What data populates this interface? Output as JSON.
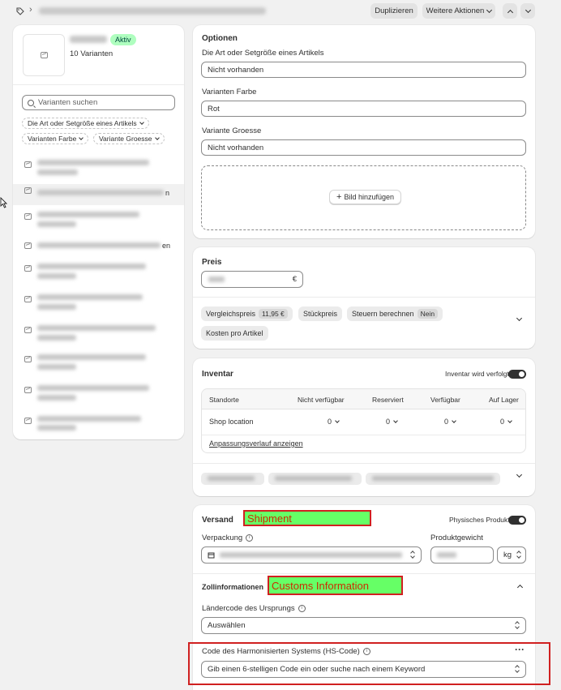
{
  "header": {
    "duplicate_label": "Duplizieren",
    "more_actions_label": "Weitere Aktionen"
  },
  "product": {
    "status": "Aktiv",
    "variant_count": "10 Varianten",
    "search_placeholder": "Varianten suchen",
    "filters": [
      "Die Art oder Setgröße eines Artikels",
      "Varianten Farbe",
      "Variante Groesse"
    ],
    "variant_trailing_text_1": "n",
    "variant_trailing_text_3": "en"
  },
  "options": {
    "title": "Optionen",
    "fields": [
      {
        "label": "Die Art oder Setgröße eines Artikels",
        "value": "Nicht vorhanden"
      },
      {
        "label": "Varianten Farbe",
        "value": "Rot"
      },
      {
        "label": "Variante Groesse",
        "value": "Nicht vorhanden"
      }
    ],
    "add_image_label": "Bild hinzufügen"
  },
  "price": {
    "title": "Preis",
    "currency": "€",
    "compare_label": "Vergleichspreis",
    "compare_value": "11,95 €",
    "unit_price_label": "Stückpreis",
    "tax_label": "Steuern berechnen",
    "tax_value": "Nein",
    "cost_label": "Kosten pro Artikel"
  },
  "inventory": {
    "title": "Inventar",
    "tracked_label": "Inventar wird verfolgt",
    "tracked": true,
    "columns": [
      "Standorte",
      "Nicht verfügbar",
      "Reserviert",
      "Verfügbar",
      "Auf Lager"
    ],
    "rows": [
      {
        "location": "Shop location",
        "unavailable": "0",
        "reserved": "0",
        "available": "0",
        "on_hand": "0"
      }
    ],
    "history_link": "Anpassungsverlauf anzeigen"
  },
  "shipping": {
    "title": "Versand",
    "physical_label": "Physisches Produkt",
    "physical": true,
    "packaging_label": "Verpackung",
    "weight_label": "Produktgewicht",
    "weight_unit": "kg",
    "customs_title": "Zollinformationen",
    "origin_label": "Ländercode des Ursprungs",
    "origin_value": "Auswählen",
    "hs_label": "Code des Harmonisierten Systems (HS-Code)",
    "hs_placeholder": "Gib einen 6-stelligen Code ein oder suche nach einem Keyword"
  },
  "annotations": {
    "shipment": "Shipment",
    "customs": "Customs Information"
  },
  "colors": {
    "badge_bg": "#affebf",
    "annotation_fill": "#66ff66",
    "annotation_border": "#d02020"
  }
}
